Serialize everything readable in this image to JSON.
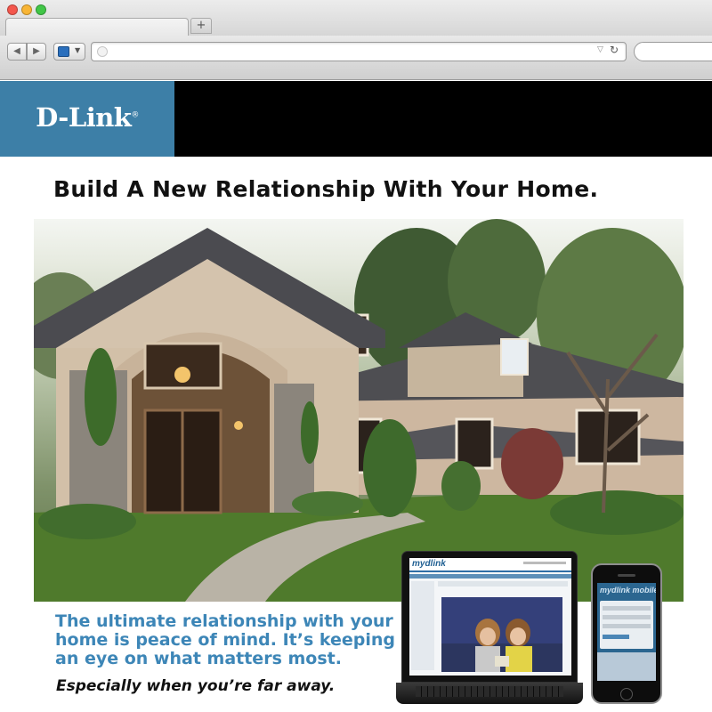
{
  "browser": {
    "new_tab_label": "+",
    "url_value": "",
    "nav": {
      "back_icon": "back-arrow-icon",
      "forward_icon": "forward-arrow-icon",
      "reload_icon": "reload-icon"
    }
  },
  "header": {
    "logo": "D-Link",
    "logo_mark": "®",
    "colors": {
      "logo_bg": "#3d7fa7",
      "bar_bg": "#000000"
    }
  },
  "main": {
    "headline": "Build A New Relationship With Your Home.",
    "tagline_lines": [
      "The ultimate relationship with your",
      "home is peace of mind. It’s keeping",
      "an eye on what matters most."
    ],
    "subtagline": "Especially when you’re far away.",
    "colors": {
      "tagline": "#3d86b7"
    }
  },
  "devices": {
    "laptop_app_logo": "mydlink",
    "phone_app_logo": "mydlink mobile"
  }
}
